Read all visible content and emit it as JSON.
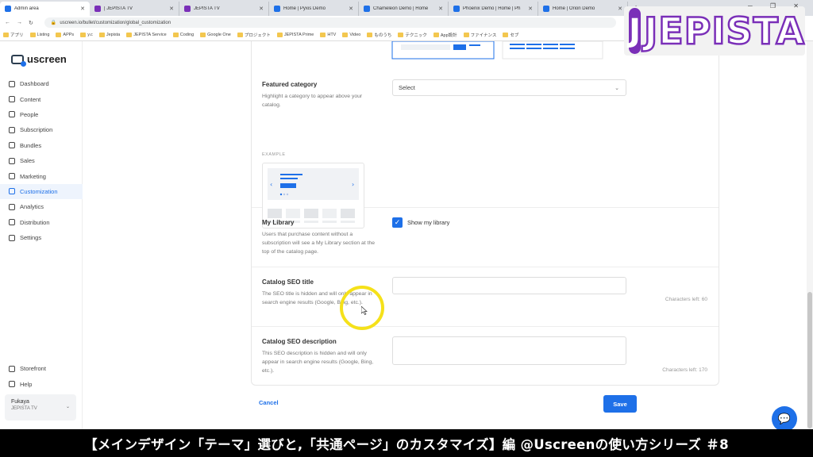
{
  "browser": {
    "tabs": [
      {
        "label": "Admin area",
        "active": true,
        "favicon": "uscreen-icon"
      },
      {
        "label": "| JEPISTA TV",
        "favicon": "jepista-icon"
      },
      {
        "label": "JEPISTA TV",
        "favicon": "jepista-icon"
      },
      {
        "label": "Home | Pyxis Demo",
        "favicon": "uscreen-icon"
      },
      {
        "label": "Chameleon Demo | Home",
        "favicon": "uscreen-icon"
      },
      {
        "label": "Phoenix Demo | Home | Ph",
        "favicon": "uscreen-icon"
      },
      {
        "label": "Home | Orion Demo",
        "favicon": "uscreen-icon"
      }
    ],
    "url": "uscreen.io/bullet/customization/global_customization",
    "bookmarks": [
      "アプリ",
      "Listing",
      "APPs",
      "y.c",
      "Jepista",
      "JEPISTA Service",
      "Coding",
      "Google One",
      "プロジェクト",
      "JEPISTA Prime",
      "HTV",
      "Video",
      "ものうち",
      "テクニック",
      "App設計",
      "ファイナンス",
      "セブ"
    ]
  },
  "overlay_logo": {
    "mark": "J",
    "word": "JEPISTA"
  },
  "sidebar": {
    "brand": "uscreen",
    "items": [
      {
        "label": "Dashboard",
        "icon": "grid-icon"
      },
      {
        "label": "Content",
        "icon": "folder-icon"
      },
      {
        "label": "People",
        "icon": "people-icon"
      },
      {
        "label": "Subscription",
        "icon": "refresh-icon"
      },
      {
        "label": "Bundles",
        "icon": "box-icon"
      },
      {
        "label": "Sales",
        "icon": "dollar-icon"
      },
      {
        "label": "Marketing",
        "icon": "megaphone-icon"
      },
      {
        "label": "Customization",
        "icon": "brush-icon",
        "active": true
      },
      {
        "label": "Analytics",
        "icon": "chart-icon"
      },
      {
        "label": "Distribution",
        "icon": "share-icon"
      },
      {
        "label": "Settings",
        "icon": "gear-icon"
      }
    ],
    "bottom": [
      {
        "label": "Storefront",
        "icon": "store-icon"
      },
      {
        "label": "Help",
        "icon": "help-icon"
      }
    ],
    "account": {
      "name": "Fukaya",
      "site": "JEPISTA TV"
    }
  },
  "main": {
    "featured": {
      "title": "Featured category",
      "desc": "Highlight a category to appear above your catalog.",
      "select_value": "Select",
      "example_label": "EXAMPLE"
    },
    "library": {
      "title": "My Library",
      "desc": "Users that purchase content without a subscription will see a My Library section at the top of the catalog page.",
      "checkbox_label": "Show my library",
      "checked": true
    },
    "seo_title": {
      "title": "Catalog SEO title",
      "desc": "The SEO title is hidden and will only appear in search engine results (Google, Bing, etc.).",
      "value": "",
      "chars_left": "Characters left: 60"
    },
    "seo_desc": {
      "title": "Catalog SEO description",
      "desc": "This SEO description is hidden and will only appear in search engine results (Google, Bing, etc.).",
      "value": "",
      "chars_left": "Characters left: 170"
    },
    "cancel_label": "Cancel",
    "save_label": "Save"
  },
  "caption": "【メインデザイン「テーマ」選びと,「共通ページ」のカスタマイズ】編 @Uscreenの使い方シリーズ ＃8",
  "colors": {
    "accent": "#1e70e8",
    "logo_purple": "#7a2fb8",
    "highlight_ring": "#f5e11a"
  }
}
